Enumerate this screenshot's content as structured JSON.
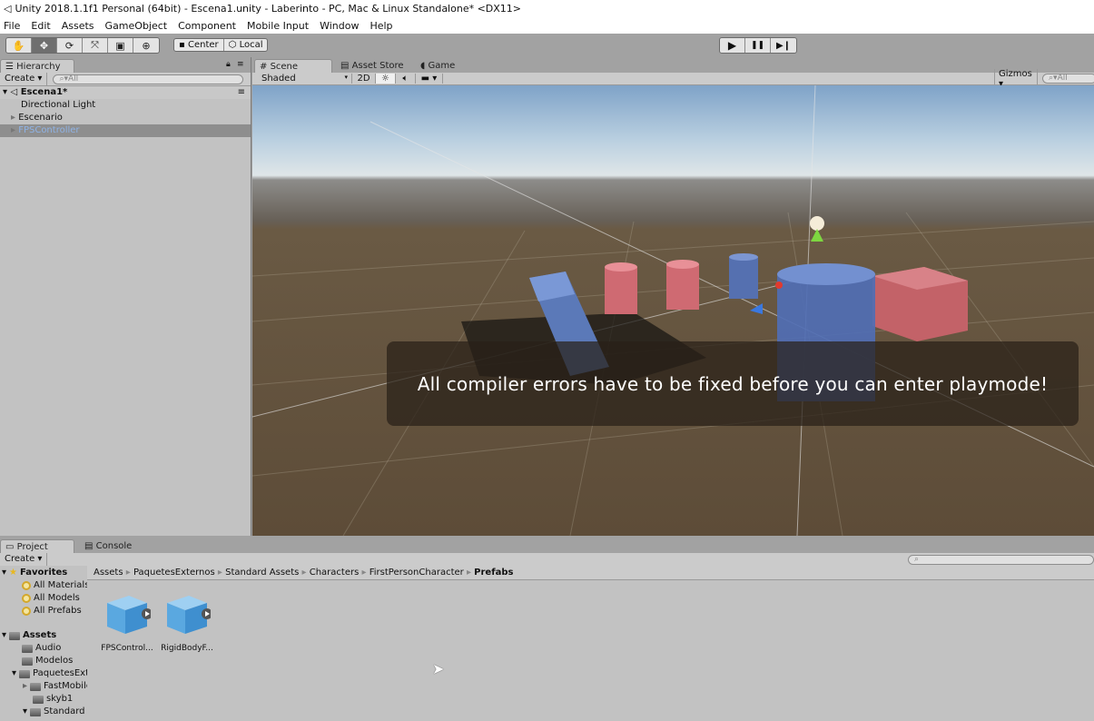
{
  "window": {
    "title": "Unity 2018.1.1f1 Personal (64bit) - Escena1.unity - Laberinto - PC, Mac & Linux Standalone* <DX11>"
  },
  "menu": [
    "File",
    "Edit",
    "Assets",
    "GameObject",
    "Component",
    "Mobile Input",
    "Window",
    "Help"
  ],
  "toolbar": {
    "tools": [
      "hand-tool",
      "move-tool",
      "rotate-tool",
      "scale-tool",
      "rect-tool",
      "transform-tool"
    ],
    "active_tool": "move-tool",
    "pivot_label": "Center",
    "space_label": "Local",
    "play_icons": {
      "play": "▶",
      "pause": "❚❚",
      "step": "▶❙"
    }
  },
  "hierarchy": {
    "tab_label": "Hierarchy",
    "create_label": "Create",
    "search_placeholder": "All",
    "scene_name": "Escena1*",
    "items": [
      {
        "label": "Directional Light",
        "expandable": false,
        "selected": false
      },
      {
        "label": "Escenario",
        "expandable": true,
        "selected": false
      },
      {
        "label": "FPSController",
        "expandable": true,
        "selected": true
      }
    ]
  },
  "scene_view": {
    "tabs": [
      {
        "label": "Scene",
        "active": true
      },
      {
        "label": "Asset Store",
        "active": false
      },
      {
        "label": "Game",
        "active": false
      }
    ],
    "shading_mode": "Shaded",
    "mode_2d": "2D",
    "gizmos_label": "Gizmos",
    "search_placeholder": "All",
    "notification": "All compiler errors have to be fixed before you can enter playmode!"
  },
  "project": {
    "tabs": [
      {
        "label": "Project",
        "active": true
      },
      {
        "label": "Console",
        "active": false
      }
    ],
    "create_label": "Create",
    "favorites_label": "Favorites",
    "favorites": [
      "All Materials",
      "All Models",
      "All Prefabs"
    ],
    "assets_label": "Assets",
    "tree": [
      {
        "label": "Audio",
        "depth": 1,
        "expand": ""
      },
      {
        "label": "Modelos",
        "depth": 1,
        "expand": ""
      },
      {
        "label": "PaquetesExternos",
        "depth": 1,
        "expand": "open"
      },
      {
        "label": "FastMobile",
        "depth": 2,
        "expand": "closed"
      },
      {
        "label": "skyb1",
        "depth": 2,
        "expand": ""
      },
      {
        "label": "Standard Assets",
        "depth": 2,
        "expand": "open"
      }
    ],
    "breadcrumb": [
      "Assets",
      "PaquetesExternos",
      "Standard Assets",
      "Characters",
      "FirstPersonCharacter",
      "Prefabs"
    ],
    "assets": [
      {
        "label": "FPSControl..."
      },
      {
        "label": "RigidBodyF..."
      }
    ]
  },
  "colors": {
    "selection_text": "#8fb3e6",
    "panel_bg": "#c2c2c2",
    "toolbar_bg": "#a2a2a2"
  }
}
